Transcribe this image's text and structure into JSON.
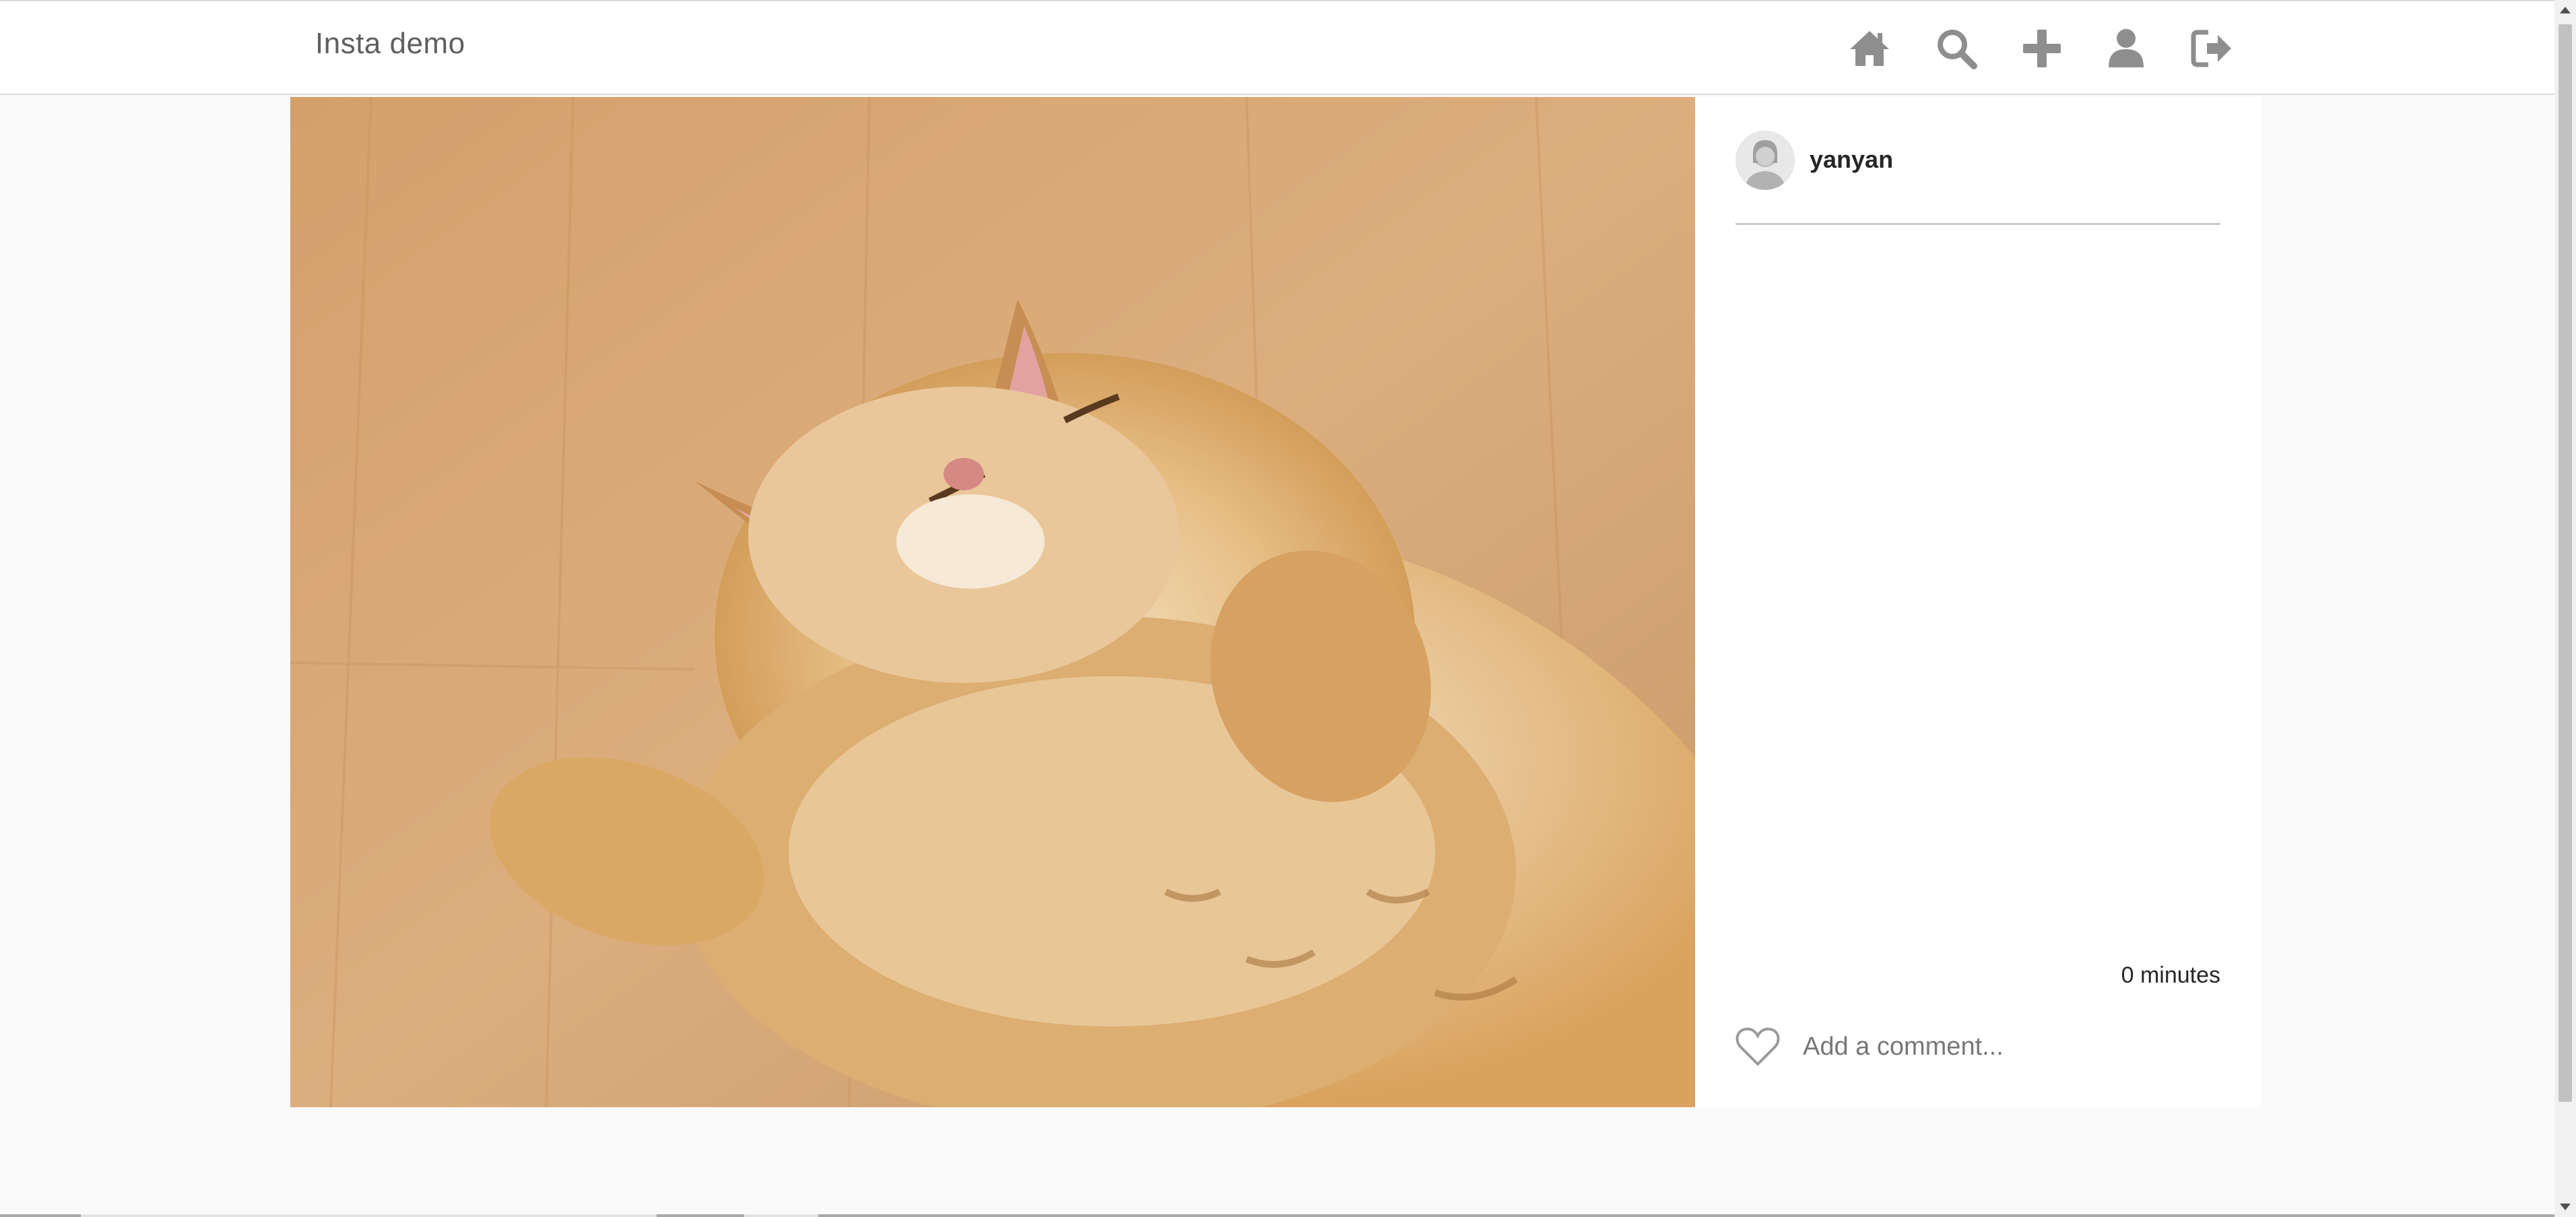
{
  "header": {
    "brand": "Insta demo",
    "icons": [
      "home-icon",
      "search-icon",
      "add-icon",
      "profile-icon",
      "logout-icon"
    ]
  },
  "post": {
    "image_alt": "Orange cat lying on its back on a wooden floor",
    "author": {
      "username": "yanyan",
      "avatar_icon": "user-avatar-icon"
    },
    "timestamp": "0 minutes",
    "like_icon": "heart-outline-icon",
    "comment": {
      "value": "",
      "placeholder": "Add a comment..."
    }
  },
  "colors": {
    "icon_gray": "#8e8e8e",
    "background": "#fafafa",
    "panel": "#ffffff",
    "divider": "#c9c9c9"
  }
}
